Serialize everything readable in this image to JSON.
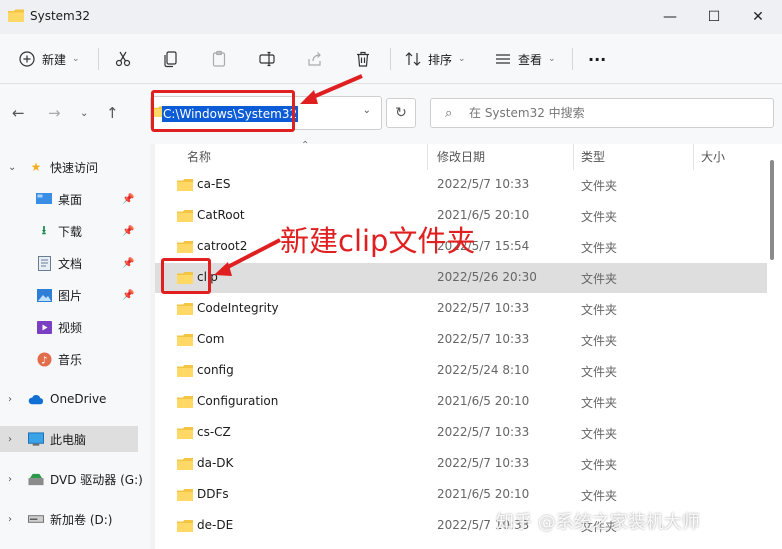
{
  "window": {
    "title": "System32",
    "minimize_label": "—",
    "maximize_label": "☐",
    "close_label": "✕"
  },
  "toolbar": {
    "new_label": "新建",
    "sort_label": "排序",
    "view_label": "查看",
    "more_label": "···"
  },
  "address_bar": {
    "path": "C:\\Windows\\System32"
  },
  "search": {
    "placeholder": "在 System32 中搜索"
  },
  "sidebar": {
    "items": [
      {
        "label": "快速访问",
        "icon": "star-icon"
      },
      {
        "label": "桌面",
        "icon": "desktop-icon"
      },
      {
        "label": "下载",
        "icon": "download-icon"
      },
      {
        "label": "文档",
        "icon": "document-icon"
      },
      {
        "label": "图片",
        "icon": "picture-icon"
      },
      {
        "label": "视频",
        "icon": "video-icon"
      },
      {
        "label": "音乐",
        "icon": "music-icon"
      },
      {
        "label": "OneDrive",
        "icon": "cloud-icon"
      },
      {
        "label": "此电脑",
        "icon": "computer-icon"
      },
      {
        "label": "DVD 驱动器 (G:)",
        "icon": "dvd-icon"
      },
      {
        "label": "新加卷 (D:)",
        "icon": "drive-icon"
      }
    ]
  },
  "columns": {
    "name": "名称",
    "date": "修改日期",
    "type": "类型",
    "size": "大小"
  },
  "files": [
    {
      "name": "ca-ES",
      "date": "2022/5/7 10:33",
      "type": "文件夹"
    },
    {
      "name": "CatRoot",
      "date": "2021/6/5 20:10",
      "type": "文件夹"
    },
    {
      "name": "catroot2",
      "date": "2022/5/7 15:54",
      "type": "文件夹"
    },
    {
      "name": "clip",
      "date": "2022/5/26 20:30",
      "type": "文件夹"
    },
    {
      "name": "CodeIntegrity",
      "date": "2022/5/7 10:33",
      "type": "文件夹"
    },
    {
      "name": "Com",
      "date": "2022/5/7 10:33",
      "type": "文件夹"
    },
    {
      "name": "config",
      "date": "2022/5/24 8:10",
      "type": "文件夹"
    },
    {
      "name": "Configuration",
      "date": "2021/6/5 20:10",
      "type": "文件夹"
    },
    {
      "name": "cs-CZ",
      "date": "2022/5/7 10:33",
      "type": "文件夹"
    },
    {
      "name": "da-DK",
      "date": "2022/5/7 10:33",
      "type": "文件夹"
    },
    {
      "name": "DDFs",
      "date": "2021/6/5 20:10",
      "type": "文件夹"
    },
    {
      "name": "de-DE",
      "date": "2022/5/7 10:33",
      "type": "文件夹"
    }
  ],
  "annotation": {
    "text": "新建clip文件夹"
  },
  "watermark": "知乎 @系统之家装机大师",
  "colors": {
    "annotation_red": "#e02020",
    "folder_yellow": "#f4c542",
    "selection_blue": "#0b5cd6"
  }
}
